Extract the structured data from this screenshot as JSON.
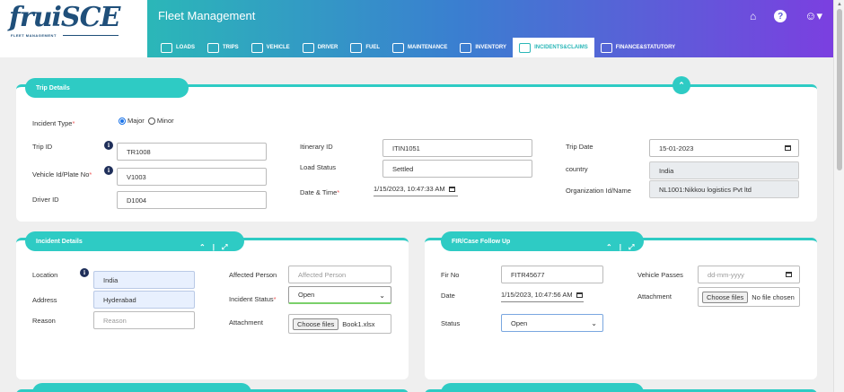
{
  "brand": {
    "name": "fruiSCE",
    "tagline": "FLEET MANAGEMENT"
  },
  "header": {
    "title": "Fleet Management"
  },
  "nav": [
    {
      "label": "LOADS",
      "icon": "loads-icon"
    },
    {
      "label": "TRIPS",
      "icon": "trips-icon"
    },
    {
      "label": "VEHICLE",
      "icon": "vehicle-icon"
    },
    {
      "label": "DRIVER",
      "icon": "driver-icon"
    },
    {
      "label": "FUEL",
      "icon": "fuel-icon"
    },
    {
      "label": "MAINTENANCE",
      "icon": "maintenance-icon"
    },
    {
      "label": "INVENTORY",
      "icon": "inventory-icon"
    },
    {
      "label": "INCIDENTS&CLAIMS",
      "icon": "incidents-icon",
      "active": true
    },
    {
      "label": "FINANCE&STATUTORY",
      "icon": "finance-icon"
    }
  ],
  "trip": {
    "title": "Trip Details",
    "incident_type_label": "Incident Type",
    "major": "Major",
    "minor": "Minor",
    "trip_id_label": "Trip ID",
    "trip_id": "TR1008",
    "vehicle_label": "Vehicle Id/Plate No",
    "vehicle": "V1003",
    "driver_label": "Driver ID",
    "driver": "D1004",
    "itinerary_label": "Itinerary ID",
    "itinerary": "ITIN1051",
    "load_status_label": "Load Status",
    "load_status": "Settled",
    "datetime_label": "Date & Time",
    "datetime": "1/15/2023, 10:47:33 AM",
    "trip_date_label": "Trip Date",
    "trip_date": "15-01-2023",
    "country_label": "country",
    "country": "India",
    "org_label": "Organization Id/Name",
    "org": "NL1001:Nikkou logistics Pvt ltd"
  },
  "incident": {
    "title": "Incident Details",
    "location_label": "Location",
    "location": "India",
    "address_label": "Address",
    "address": "Hyderabad",
    "reason_label": "Reason",
    "reason_placeholder": "Reason",
    "affected_label": "Affected Person",
    "affected_placeholder": "Affected Person",
    "status_label": "Incident Status",
    "status": "Open",
    "attachment_label": "Attachment",
    "choose_files": "Choose files",
    "file_name": "Book1.xlsx"
  },
  "fir": {
    "title": "FIR/Case Follow Up",
    "fir_no_label": "Fir No",
    "fir_no": "FITR45677",
    "date_label": "Date",
    "date": "1/15/2023, 10:47:56 AM",
    "status_label": "Status",
    "status": "Open",
    "vehicle_passes_label": "Vehicle Passes",
    "vehicle_passes_placeholder": "dd-mm-yyyy",
    "attachment_label": "Attachment",
    "choose_files": "Choose files",
    "no_file": "No file chosen"
  },
  "colors": {
    "accent": "#2ecbc4",
    "header_start": "#2bb7b8",
    "header_end": "#7b3fe0",
    "brand": "#1f4f7a"
  }
}
